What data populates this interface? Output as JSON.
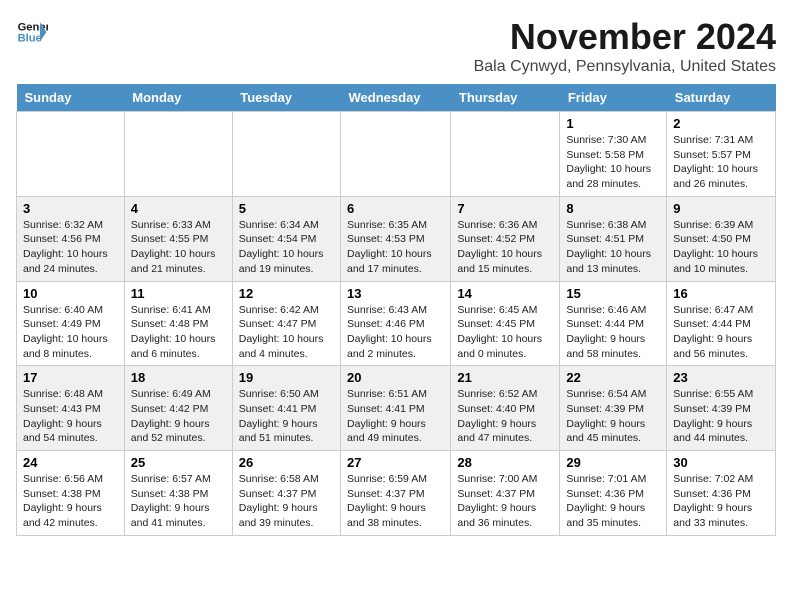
{
  "header": {
    "logo_line1": "General",
    "logo_line2": "Blue",
    "month_title": "November 2024",
    "location": "Bala Cynwyd, Pennsylvania, United States"
  },
  "weekdays": [
    "Sunday",
    "Monday",
    "Tuesday",
    "Wednesday",
    "Thursday",
    "Friday",
    "Saturday"
  ],
  "weeks": [
    [
      {
        "day": "",
        "info": ""
      },
      {
        "day": "",
        "info": ""
      },
      {
        "day": "",
        "info": ""
      },
      {
        "day": "",
        "info": ""
      },
      {
        "day": "",
        "info": ""
      },
      {
        "day": "1",
        "info": "Sunrise: 7:30 AM\nSunset: 5:58 PM\nDaylight: 10 hours and 28 minutes."
      },
      {
        "day": "2",
        "info": "Sunrise: 7:31 AM\nSunset: 5:57 PM\nDaylight: 10 hours and 26 minutes."
      }
    ],
    [
      {
        "day": "3",
        "info": "Sunrise: 6:32 AM\nSunset: 4:56 PM\nDaylight: 10 hours and 24 minutes."
      },
      {
        "day": "4",
        "info": "Sunrise: 6:33 AM\nSunset: 4:55 PM\nDaylight: 10 hours and 21 minutes."
      },
      {
        "day": "5",
        "info": "Sunrise: 6:34 AM\nSunset: 4:54 PM\nDaylight: 10 hours and 19 minutes."
      },
      {
        "day": "6",
        "info": "Sunrise: 6:35 AM\nSunset: 4:53 PM\nDaylight: 10 hours and 17 minutes."
      },
      {
        "day": "7",
        "info": "Sunrise: 6:36 AM\nSunset: 4:52 PM\nDaylight: 10 hours and 15 minutes."
      },
      {
        "day": "8",
        "info": "Sunrise: 6:38 AM\nSunset: 4:51 PM\nDaylight: 10 hours and 13 minutes."
      },
      {
        "day": "9",
        "info": "Sunrise: 6:39 AM\nSunset: 4:50 PM\nDaylight: 10 hours and 10 minutes."
      }
    ],
    [
      {
        "day": "10",
        "info": "Sunrise: 6:40 AM\nSunset: 4:49 PM\nDaylight: 10 hours and 8 minutes."
      },
      {
        "day": "11",
        "info": "Sunrise: 6:41 AM\nSunset: 4:48 PM\nDaylight: 10 hours and 6 minutes."
      },
      {
        "day": "12",
        "info": "Sunrise: 6:42 AM\nSunset: 4:47 PM\nDaylight: 10 hours and 4 minutes."
      },
      {
        "day": "13",
        "info": "Sunrise: 6:43 AM\nSunset: 4:46 PM\nDaylight: 10 hours and 2 minutes."
      },
      {
        "day": "14",
        "info": "Sunrise: 6:45 AM\nSunset: 4:45 PM\nDaylight: 10 hours and 0 minutes."
      },
      {
        "day": "15",
        "info": "Sunrise: 6:46 AM\nSunset: 4:44 PM\nDaylight: 9 hours and 58 minutes."
      },
      {
        "day": "16",
        "info": "Sunrise: 6:47 AM\nSunset: 4:44 PM\nDaylight: 9 hours and 56 minutes."
      }
    ],
    [
      {
        "day": "17",
        "info": "Sunrise: 6:48 AM\nSunset: 4:43 PM\nDaylight: 9 hours and 54 minutes."
      },
      {
        "day": "18",
        "info": "Sunrise: 6:49 AM\nSunset: 4:42 PM\nDaylight: 9 hours and 52 minutes."
      },
      {
        "day": "19",
        "info": "Sunrise: 6:50 AM\nSunset: 4:41 PM\nDaylight: 9 hours and 51 minutes."
      },
      {
        "day": "20",
        "info": "Sunrise: 6:51 AM\nSunset: 4:41 PM\nDaylight: 9 hours and 49 minutes."
      },
      {
        "day": "21",
        "info": "Sunrise: 6:52 AM\nSunset: 4:40 PM\nDaylight: 9 hours and 47 minutes."
      },
      {
        "day": "22",
        "info": "Sunrise: 6:54 AM\nSunset: 4:39 PM\nDaylight: 9 hours and 45 minutes."
      },
      {
        "day": "23",
        "info": "Sunrise: 6:55 AM\nSunset: 4:39 PM\nDaylight: 9 hours and 44 minutes."
      }
    ],
    [
      {
        "day": "24",
        "info": "Sunrise: 6:56 AM\nSunset: 4:38 PM\nDaylight: 9 hours and 42 minutes."
      },
      {
        "day": "25",
        "info": "Sunrise: 6:57 AM\nSunset: 4:38 PM\nDaylight: 9 hours and 41 minutes."
      },
      {
        "day": "26",
        "info": "Sunrise: 6:58 AM\nSunset: 4:37 PM\nDaylight: 9 hours and 39 minutes."
      },
      {
        "day": "27",
        "info": "Sunrise: 6:59 AM\nSunset: 4:37 PM\nDaylight: 9 hours and 38 minutes."
      },
      {
        "day": "28",
        "info": "Sunrise: 7:00 AM\nSunset: 4:37 PM\nDaylight: 9 hours and 36 minutes."
      },
      {
        "day": "29",
        "info": "Sunrise: 7:01 AM\nSunset: 4:36 PM\nDaylight: 9 hours and 35 minutes."
      },
      {
        "day": "30",
        "info": "Sunrise: 7:02 AM\nSunset: 4:36 PM\nDaylight: 9 hours and 33 minutes."
      }
    ]
  ]
}
